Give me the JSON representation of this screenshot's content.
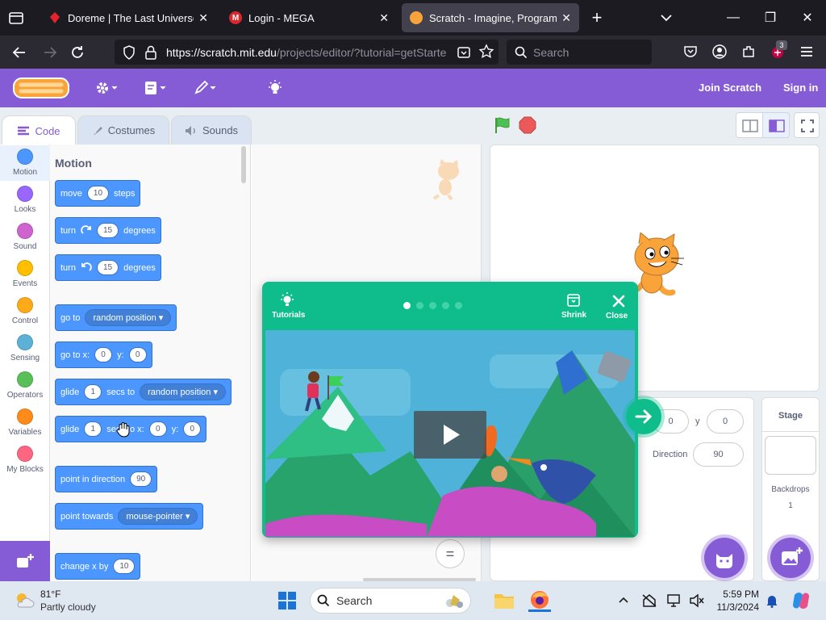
{
  "browser": {
    "tabs": [
      {
        "title": "Doreme | The Last Universe Wik",
        "active": false
      },
      {
        "title": "Login - MEGA",
        "active": false
      },
      {
        "title": "Scratch - Imagine, Program, Sh",
        "active": true
      }
    ],
    "url_host": "https://scratch.mit.edu",
    "url_path": "/projects/editor/?tutorial=getStarte",
    "search_placeholder": "Search",
    "extension_badge": "3"
  },
  "scratch": {
    "menu": {
      "join": "Join Scratch",
      "signin": "Sign in"
    },
    "editor_tabs": [
      "Code",
      "Costumes",
      "Sounds"
    ],
    "categories": [
      {
        "label": "Motion",
        "color": "#4c97ff"
      },
      {
        "label": "Looks",
        "color": "#9966ff"
      },
      {
        "label": "Sound",
        "color": "#cf63cf"
      },
      {
        "label": "Events",
        "color": "#ffbf00"
      },
      {
        "label": "Control",
        "color": "#ffab19"
      },
      {
        "label": "Sensing",
        "color": "#5cb1d6"
      },
      {
        "label": "Operators",
        "color": "#59c059"
      },
      {
        "label": "Variables",
        "color": "#ff8c1a"
      },
      {
        "label": "My Blocks",
        "color": "#ff6680"
      }
    ],
    "palette_title": "Motion",
    "blocks": {
      "move": {
        "a": "move",
        "v": "10",
        "b": "steps"
      },
      "turn_right": {
        "a": "turn",
        "v": "15",
        "b": "degrees"
      },
      "turn_left": {
        "a": "turn",
        "v": "15",
        "b": "degrees"
      },
      "goto": {
        "a": "go to",
        "dd": "random position"
      },
      "gotoxy": {
        "a": "go to x:",
        "x": "0",
        "b": "y:",
        "y": "0"
      },
      "glide_to": {
        "a": "glide",
        "v": "1",
        "b": "secs to",
        "dd": "random position"
      },
      "glide_xy": {
        "a": "glide",
        "v": "1",
        "b": "secs to x:",
        "x": "0",
        "c": "y:",
        "y": "0"
      },
      "point_dir": {
        "a": "point in direction",
        "v": "90"
      },
      "point_towards": {
        "a": "point towards",
        "dd": "mouse-pointer"
      },
      "change_x": {
        "a": "change x by",
        "v": "10"
      }
    },
    "sprite_info": {
      "x_value": "0",
      "y_label": "y",
      "y_value": "0",
      "direction_label": "Direction",
      "direction_value": "90"
    },
    "stage_panel": {
      "title": "Stage",
      "backdrops_label": "Backdrops",
      "backdrops_count": "1"
    },
    "tutorial": {
      "tutorials_label": "Tutorials",
      "shrink_label": "Shrink",
      "close_label": "Close",
      "page_count": 5,
      "current_page": 1
    }
  },
  "taskbar": {
    "weather_temp": "81°F",
    "weather_desc": "Partly cloudy",
    "search_label": "Search",
    "time": "5:59 PM",
    "date": "11/3/2024"
  }
}
